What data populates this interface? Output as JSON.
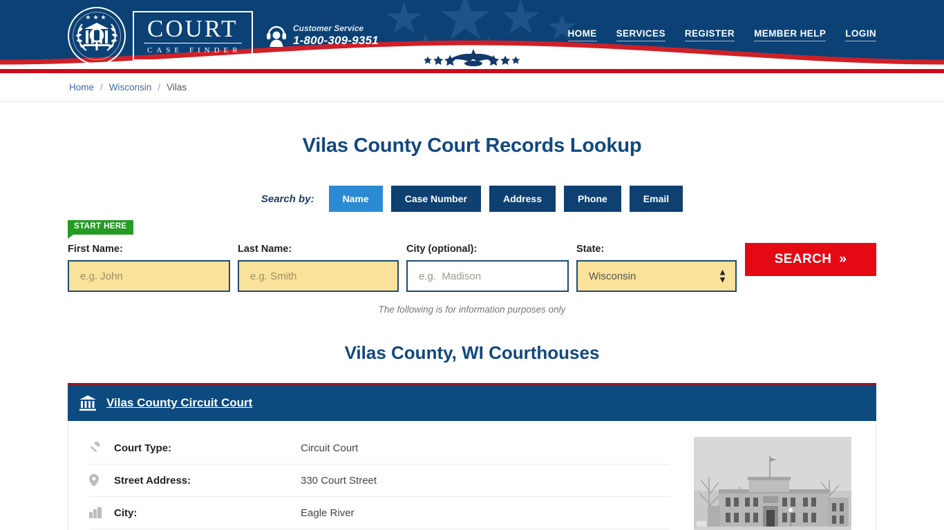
{
  "header": {
    "logo": {
      "seal_icon": "court-seal-icon",
      "brand": "COURT",
      "tagline": "CASE FINDER"
    },
    "customer_service": {
      "icon": "headset-support-icon",
      "label": "Customer Service",
      "phone": "1-800-309-9351"
    },
    "nav": [
      {
        "label": "HOME",
        "name": "nav-home"
      },
      {
        "label": "SERVICES",
        "name": "nav-services"
      },
      {
        "label": "REGISTER",
        "name": "nav-register"
      },
      {
        "label": "MEMBER HELP",
        "name": "nav-member-help"
      },
      {
        "label": "LOGIN",
        "name": "nav-login"
      }
    ],
    "eagle_icon": "eagle-stars-emblem",
    "colors": {
      "navy": "#0b4175",
      "red": "#d00a18",
      "star": "#1d5386"
    }
  },
  "breadcrumb": {
    "home": "Home",
    "state": "Wisconsin",
    "county": "Vilas",
    "separator": "/"
  },
  "main": {
    "page_title": "Vilas County Court Records Lookup",
    "search_by_label": "Search by:",
    "tabs": [
      {
        "label": "Name",
        "active": true
      },
      {
        "label": "Case Number",
        "active": false
      },
      {
        "label": "Address",
        "active": false
      },
      {
        "label": "Phone",
        "active": false
      },
      {
        "label": "Email",
        "active": false
      }
    ],
    "start_here_badge": "START HERE",
    "form": {
      "first_name_label": "First Name:",
      "first_name_value": "",
      "first_name_placeholder": "e.g. John",
      "last_name_label": "Last Name:",
      "last_name_value": "",
      "last_name_placeholder": "e.g. Smith",
      "city_label": "City (optional):",
      "city_value": "",
      "city_placeholder": "e.g.  Madison",
      "state_label": "State:",
      "state_value": "Wisconsin",
      "search_button": "SEARCH",
      "search_button_icon": "double-chevron-right-icon"
    },
    "disclaimer": "The following is for information purposes only",
    "section_title": "Vilas County, WI Courthouses"
  },
  "court_card": {
    "icon": "courthouse-bank-icon",
    "title": "Vilas County Circuit Court",
    "photo_alt": "vilas-county-courthouse-photo",
    "rows": [
      {
        "icon": "gavel-icon",
        "label": "Court Type:",
        "value": "Circuit Court"
      },
      {
        "icon": "map-pin-icon",
        "label": "Street Address:",
        "value": "330 Court Street"
      },
      {
        "icon": "city-buildings-icon",
        "label": "City:",
        "value": "Eagle River"
      }
    ]
  }
}
